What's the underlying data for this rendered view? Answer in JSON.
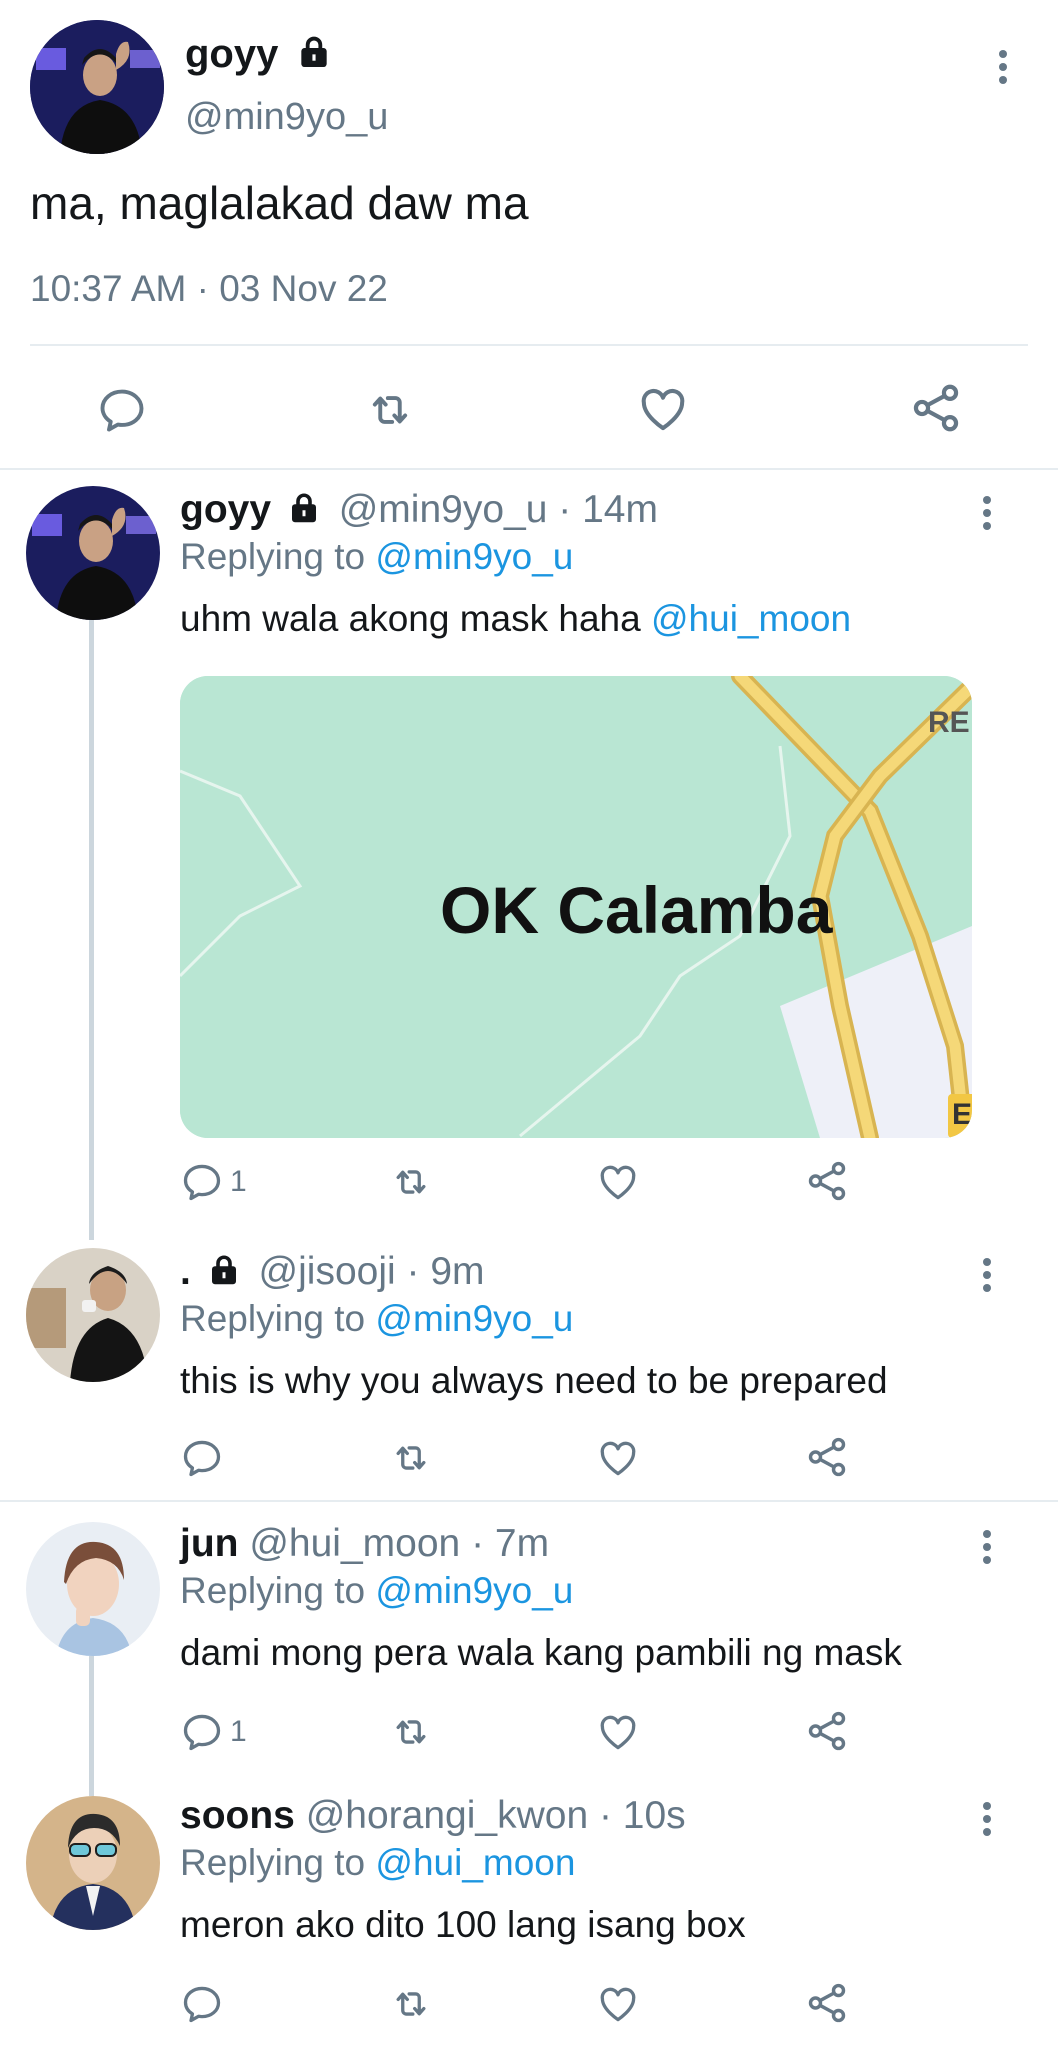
{
  "main_tweet": {
    "display_name": "goyy",
    "handle": "@min9yo_u",
    "text": "ma, maglalakad daw ma",
    "timestamp": "10:37 AM · 03 Nov 22"
  },
  "replies": [
    {
      "display_name": "goyy",
      "handle": "@min9yo_u",
      "age": "· 14m",
      "replying_label": "Replying to",
      "replying_to": "@min9yo_u",
      "text": "uhm wala akong mask haha",
      "mention": "@hui_moon",
      "reply_count": "1",
      "media": {
        "map_label": "OK Calamba",
        "corner_label": "RE",
        "marker_label": "E"
      }
    },
    {
      "display_name": ".",
      "handle": "@jisooji",
      "age": "· 9m",
      "replying_label": "Replying to",
      "replying_to": "@min9yo_u",
      "text": "this is why you always need to be prepared",
      "reply_count": ""
    },
    {
      "display_name": "jun",
      "handle": "@hui_moon",
      "age": "· 7m",
      "replying_label": "Replying to",
      "replying_to": "@min9yo_u",
      "text": "dami mong pera wala kang pambili ng mask",
      "reply_count": "1"
    },
    {
      "display_name": "soons",
      "handle": "@horangi_kwon",
      "age": "· 10s",
      "replying_label": "Replying to",
      "replying_to": "@hui_moon",
      "text": "meron ako dito 100 lang isang box",
      "reply_count": ""
    }
  ],
  "icons": {
    "reply": "reply-icon",
    "retweet": "retweet-icon",
    "like": "like-icon",
    "share": "share-icon",
    "more": "more-icon",
    "lock": "lock-icon"
  },
  "colors": {
    "link": "#1b95e0",
    "muted": "#657786",
    "map_bg": "#b9e6d3",
    "road": "#f2d06b"
  }
}
